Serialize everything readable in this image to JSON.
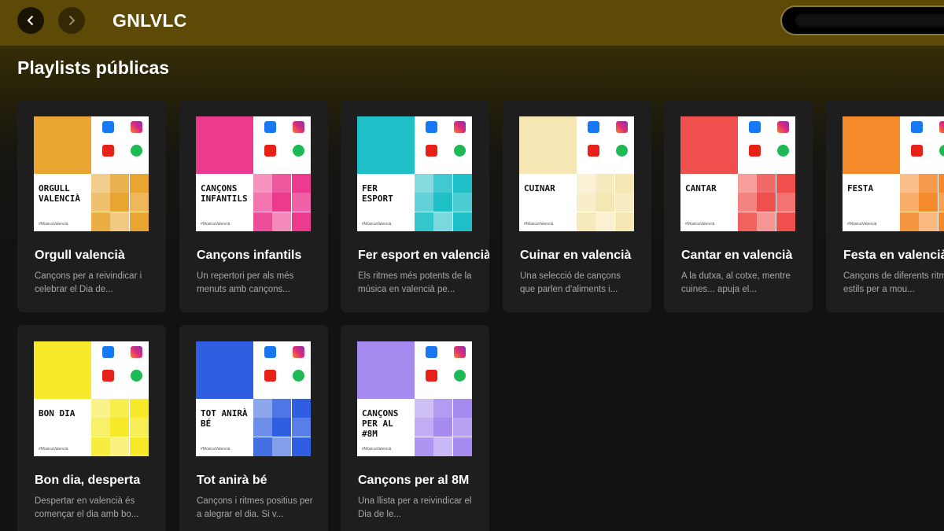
{
  "header": {
    "title": "GNLVLC"
  },
  "section": {
    "title": "Playlists públicas"
  },
  "cards": [
    {
      "title": "Orgull valencià",
      "desc": "Cançons per a reivindicar i celebrar el Dia de...",
      "label": "ORGULL VALENCIÀ",
      "tag": "#MúsicaValencià",
      "accent": "#e8a531"
    },
    {
      "title": "Cançons infantils",
      "desc": "Un repertori per als més menuts amb cançons...",
      "label": "CANÇONS INFANTILS",
      "tag": "#MúsicaValencià",
      "accent": "#ec3a8e"
    },
    {
      "title": "Fer esport en valencià",
      "desc": "Els ritmes més potents de la música en valencià pe...",
      "label": "FER ESPORT",
      "tag": "#MúsicaValencià",
      "accent": "#1fbfc8"
    },
    {
      "title": "Cuinar en valencià",
      "desc": "Una selecció de cançons que parlen d'aliments i...",
      "label": "CUINAR",
      "tag": "#MúsicaValencià",
      "accent": "#f5e7b4"
    },
    {
      "title": "Cantar en valencià",
      "desc": "A la dutxa, al cotxe, mentre cuines... apuja el...",
      "label": "CANTAR",
      "tag": "#MúsicaValencià",
      "accent": "#f0504d"
    },
    {
      "title": "Festa en valencià",
      "desc": "Cançons de diferents ritmes i estils per a mou...",
      "label": "FESTA",
      "tag": "#MúsicaValencià",
      "accent": "#f58a2b"
    },
    {
      "title": "Bon dia, desperta",
      "desc": "Despertar en valencià és començar el dia amb bo...",
      "label": "BON DIA",
      "tag": "#MúsicaValencià",
      "accent": "#f6ea2b"
    },
    {
      "title": "Tot anirà bé",
      "desc": "Cançons i ritmes positius per a alegrar el dia. Si v...",
      "label": "TOT ANIRÀ BÉ",
      "tag": "#MúsicaValencià",
      "accent": "#2f5fe0"
    },
    {
      "title": "Cançons per al 8M",
      "desc": "Una llista per a reivindicar el Dia de le...",
      "label": "CANÇONS PER AL #8M",
      "tag": "#MúsicaValencià",
      "accent": "#a58af0"
    }
  ]
}
